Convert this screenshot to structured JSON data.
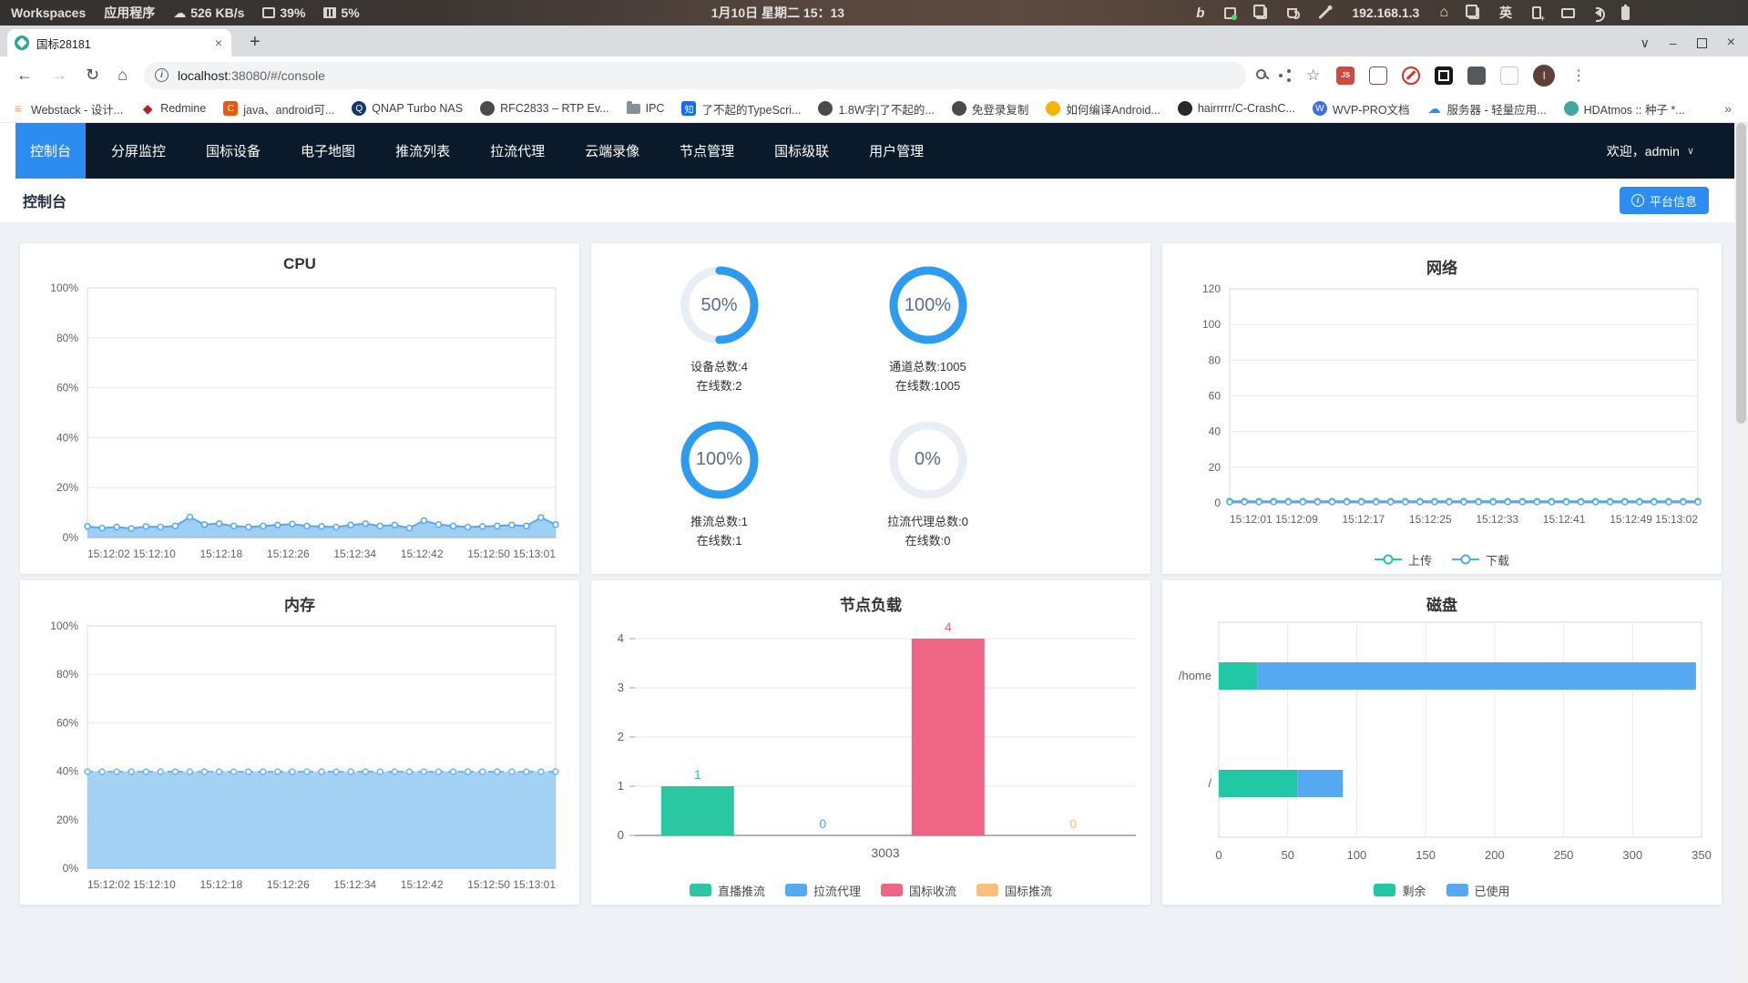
{
  "desktop_bar": {
    "workspaces": "Workspaces",
    "applications": "应用程序",
    "net_speed": "526 KB/s",
    "cpu": "39%",
    "memory": "5%",
    "clock": "1月10日 星期二  15：13",
    "ip": "192.168.1.3",
    "bing": "b",
    "input_method": "英"
  },
  "browser": {
    "tab_title": "国标28181",
    "tab_close": "×",
    "new_tab": "+",
    "back": "←",
    "forward": "→",
    "reload": "↻",
    "home": "⌂",
    "url_host": "localhost",
    "url_rest": ":38080/#/console",
    "star": "☆",
    "menu": "⋮",
    "avatar_letter": "l",
    "win_chevron": "∨",
    "win_min": "–",
    "win_close": "×"
  },
  "bookmarks": {
    "items": [
      {
        "label": "Webstack - 设计..."
      },
      {
        "label": "Redmine"
      },
      {
        "label": "java、android可..."
      },
      {
        "label": "QNAP Turbo NAS"
      },
      {
        "label": "RFC2833 – RTP Ev..."
      },
      {
        "label": "IPC"
      },
      {
        "label": "了不起的TypeScri..."
      },
      {
        "label": "1.8W字|了不起的..."
      },
      {
        "label": "免登录复制"
      },
      {
        "label": "如何编译Android..."
      },
      {
        "label": "hairrrrr/C-CrashC..."
      },
      {
        "label": "WVP-PRO文档"
      },
      {
        "label": "服务器 - 轻量应用..."
      },
      {
        "label": "HDAtmos :: 种子 *..."
      }
    ],
    "overflow": "»"
  },
  "nav": {
    "items": [
      {
        "label": "控制台",
        "active": true
      },
      {
        "label": "分屏监控"
      },
      {
        "label": "国标设备"
      },
      {
        "label": "电子地图"
      },
      {
        "label": "推流列表"
      },
      {
        "label": "拉流代理"
      },
      {
        "label": "云端录像"
      },
      {
        "label": "节点管理"
      },
      {
        "label": "国标级联"
      },
      {
        "label": "用户管理"
      }
    ],
    "welcome": "欢迎，admin"
  },
  "header": {
    "title": "控制台",
    "platform_info": "平台信息"
  },
  "gauges": [
    {
      "percent": "50%",
      "value": 50,
      "line1": "设备总数:4",
      "line2": "在线数:2"
    },
    {
      "percent": "100%",
      "value": 100,
      "line1": "通道总数:1005",
      "line2": "在线数:1005"
    },
    {
      "percent": "100%",
      "value": 100,
      "line1": "推流总数:1",
      "line2": "在线数:1"
    },
    {
      "percent": "0%",
      "value": 0,
      "line1": "拉流代理总数:0",
      "line2": "在线数:0"
    }
  ],
  "colors": {
    "accent_blue": "#2d8cf0",
    "ring_blue": "#2d9cf0",
    "ring_track": "#e9edf4",
    "teal": "#2bc7a2",
    "blue": "#56a8f0",
    "pink": "#ee6684",
    "orange": "#fcbe7b",
    "chart_line": "#57a8ee"
  },
  "chart_data": [
    {
      "type": "area",
      "title": "CPU",
      "ylim": [
        0,
        100
      ],
      "y_ticks": [
        0,
        20,
        40,
        60,
        80,
        100
      ],
      "y_suffix": "%",
      "x_labels": [
        "15:12:02",
        "15:12:10",
        "15:12:18",
        "15:12:26",
        "15:12:34",
        "15:12:42",
        "15:12:50",
        "15:13:01"
      ],
      "color": "#57a8ee",
      "fill": "rgba(141,199,243,0.85)",
      "values": [
        4.5,
        3.8,
        4.2,
        3.6,
        4.4,
        4.2,
        4.6,
        8.2,
        5.2,
        5.6,
        4.6,
        4.2,
        4.6,
        5.0,
        5.4,
        4.6,
        4.4,
        4.2,
        5.0,
        5.6,
        4.6,
        5.0,
        3.8,
        6.8,
        5.2,
        4.6,
        4.2,
        4.4,
        4.6,
        5.0,
        4.6,
        8.0,
        5.2
      ]
    },
    {
      "type": "line",
      "title": "网络",
      "ylim": [
        0,
        120
      ],
      "y_ticks": [
        0,
        20,
        40,
        60,
        80,
        100,
        120
      ],
      "y_suffix": "",
      "x_labels": [
        "15:12:01",
        "15:12:09",
        "15:12:17",
        "15:12:25",
        "15:12:33",
        "15:12:41",
        "15:12:49",
        "15:13:02"
      ],
      "legend_marker": "ring",
      "series": [
        {
          "name": "上传",
          "color": "#2bc7a2",
          "values": [
            0.9,
            0.9,
            0.9,
            0.9,
            0.9,
            0.9,
            0.9,
            0.9,
            0.9,
            0.9,
            0.9,
            0.9,
            0.9,
            0.9,
            0.9,
            0.9,
            0.9,
            0.9,
            0.9,
            0.9,
            0.9,
            0.9,
            0.9,
            0.9,
            0.9,
            0.9,
            0.9,
            0.9,
            0.9,
            0.9,
            0.9,
            0.9,
            0.9
          ]
        },
        {
          "name": "下载",
          "color": "#56a8f0",
          "values": [
            0.5,
            0.5,
            0.5,
            0.5,
            0.5,
            0.5,
            0.5,
            0.5,
            0.5,
            0.5,
            0.5,
            0.5,
            0.5,
            0.5,
            0.5,
            0.5,
            0.5,
            0.5,
            0.5,
            0.5,
            0.5,
            0.5,
            0.5,
            0.5,
            0.5,
            0.5,
            0.5,
            0.5,
            0.5,
            0.5,
            0.5,
            0.5,
            0.5
          ]
        }
      ]
    },
    {
      "type": "area",
      "title": "内存",
      "ylim": [
        0,
        100
      ],
      "y_ticks": [
        0,
        20,
        40,
        60,
        80,
        100
      ],
      "y_suffix": "%",
      "x_labels": [
        "15:12:02",
        "15:12:10",
        "15:12:18",
        "15:12:26",
        "15:12:34",
        "15:12:42",
        "15:12:50",
        "15:13:01"
      ],
      "color": "#6fb3f2",
      "fill": "rgba(141,199,243,0.8)",
      "dashed": true,
      "values": [
        39.8,
        39.8,
        39.8,
        39.8,
        39.8,
        39.8,
        39.8,
        39.8,
        39.8,
        39.8,
        39.8,
        39.8,
        39.8,
        39.8,
        39.8,
        39.8,
        39.8,
        39.8,
        39.8,
        39.8,
        39.8,
        39.8,
        39.8,
        39.8,
        39.8,
        39.8,
        39.8,
        39.8,
        39.8,
        39.8,
        39.8,
        39.8,
        39.8
      ]
    },
    {
      "type": "bar",
      "title": "节点负载",
      "ylim": [
        0,
        4
      ],
      "y_ticks": [
        0,
        1,
        2,
        3,
        4
      ],
      "categories": [
        "3003"
      ],
      "legend_marker": "rect",
      "series": [
        {
          "name": "直播推流",
          "color": "#2bc7a2",
          "values": [
            1
          ]
        },
        {
          "name": "拉流代理",
          "color": "#56a8f0",
          "values": [
            0
          ]
        },
        {
          "name": "国标收流",
          "color": "#ee6684",
          "values": [
            4
          ]
        },
        {
          "name": "国标推流",
          "color": "#fcbe7b",
          "values": [
            0
          ]
        }
      ]
    },
    {
      "type": "hbar",
      "title": "磁盘",
      "xlim": [
        0,
        350
      ],
      "x_ticks": [
        0,
        50,
        100,
        150,
        200,
        250,
        300,
        350
      ],
      "categories": [
        "/home",
        "/"
      ],
      "legend_marker": "rect",
      "series": [
        {
          "name": "剩余",
          "color": "#22c7a5",
          "values": [
            28,
            57
          ]
        },
        {
          "name": "已使用",
          "color": "#56a8f0",
          "values": [
            318,
            33
          ]
        }
      ]
    }
  ]
}
